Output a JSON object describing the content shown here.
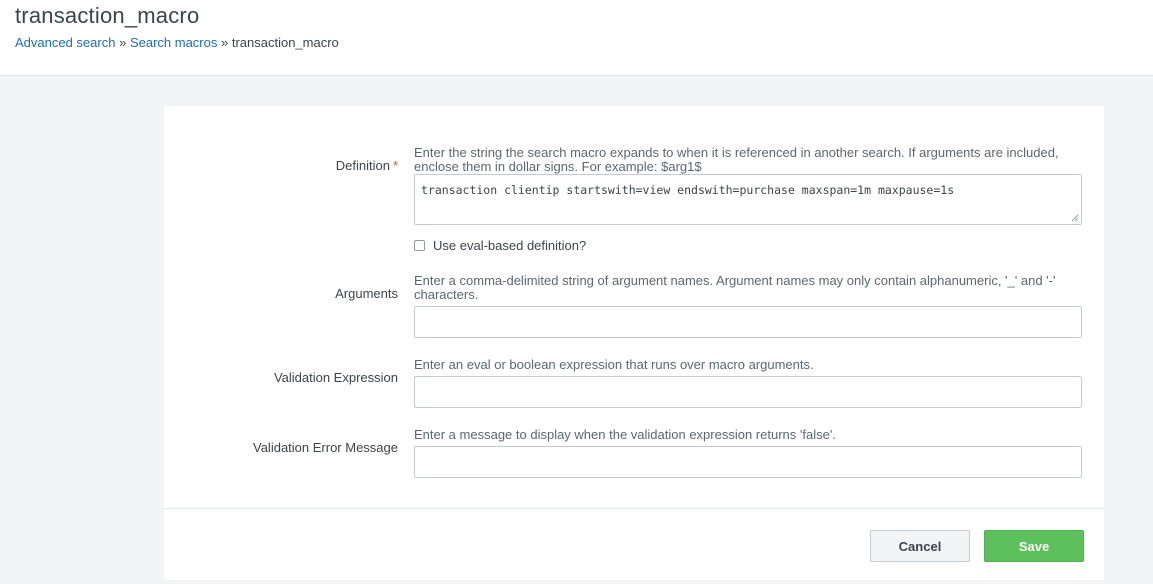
{
  "page": {
    "title": "transaction_macro",
    "breadcrumb": {
      "items": [
        "Advanced search",
        "Search macros",
        "transaction_macro"
      ],
      "separator": "»"
    }
  },
  "form": {
    "definition": {
      "label": "Definition",
      "required_marker": "*",
      "help": "Enter the string the search macro expands to when it is referenced in another search. If arguments are included, enclose them in dollar signs. For example: $arg1$",
      "value": "transaction clientip startswith=view endswith=purchase maxspan=1m maxpause=1s"
    },
    "eval_checkbox": {
      "label": "Use eval-based definition?",
      "checked": false
    },
    "arguments": {
      "label": "Arguments",
      "help": "Enter a comma-delimited string of argument names. Argument names may only contain alphanumeric, '_' and '-' characters.",
      "value": ""
    },
    "validation_expression": {
      "label": "Validation Expression",
      "help": "Enter an eval or boolean expression that runs over macro arguments.",
      "value": ""
    },
    "validation_error_message": {
      "label": "Validation Error Message",
      "help": "Enter a message to display when the validation expression returns 'false'.",
      "value": ""
    }
  },
  "footer": {
    "cancel_label": "Cancel",
    "save_label": "Save"
  },
  "colors": {
    "link": "#1a6fb4",
    "required": "#d6563c",
    "save_button": "#5cc05c",
    "background": "#f2f4f5"
  }
}
